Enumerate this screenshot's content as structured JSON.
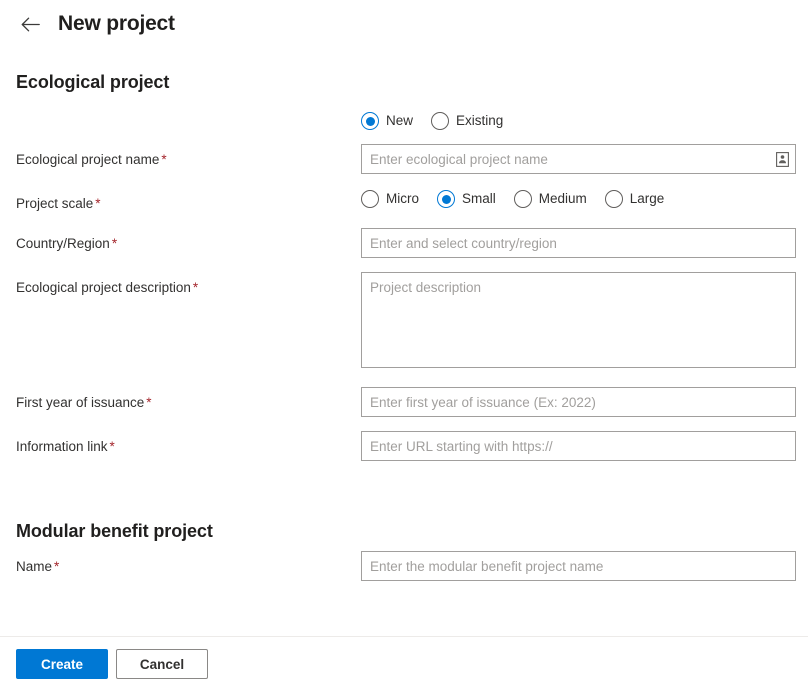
{
  "header": {
    "back_icon": "back-arrow-icon",
    "title": "New project"
  },
  "sections": {
    "ecological": {
      "title": "Ecological project",
      "mode": {
        "options": [
          "New",
          "Existing"
        ],
        "selected": "New"
      },
      "fields": {
        "name": {
          "label": "Ecological project name",
          "required_marker": "*",
          "placeholder": "Enter ecological project name",
          "value": "",
          "icon": "id-card-icon"
        },
        "scale": {
          "label": "Project scale",
          "required_marker": "*",
          "options": [
            "Micro",
            "Small",
            "Medium",
            "Large"
          ],
          "selected": "Small"
        },
        "country": {
          "label": "Country/Region",
          "required_marker": "*",
          "placeholder": "Enter and select country/region",
          "value": ""
        },
        "description": {
          "label": "Ecological project description",
          "required_marker": "*",
          "placeholder": "Project description",
          "value": ""
        },
        "first_year": {
          "label": "First year of issuance",
          "required_marker": "*",
          "placeholder": "Enter first year of issuance (Ex: 2022)",
          "value": ""
        },
        "info_link": {
          "label": "Information link",
          "required_marker": "*",
          "placeholder": "Enter URL starting with https://",
          "value": ""
        }
      }
    },
    "modular": {
      "title": "Modular benefit project",
      "fields": {
        "name": {
          "label": "Name",
          "required_marker": "*",
          "placeholder": "Enter the modular benefit project name",
          "value": ""
        }
      }
    }
  },
  "footer": {
    "create_label": "Create",
    "cancel_label": "Cancel"
  },
  "colors": {
    "accent": "#0078d4",
    "required": "#a4262c",
    "border": "#a19f9d",
    "placeholder": "#a19f9d",
    "divider": "#edebe9",
    "text": "#323130"
  }
}
